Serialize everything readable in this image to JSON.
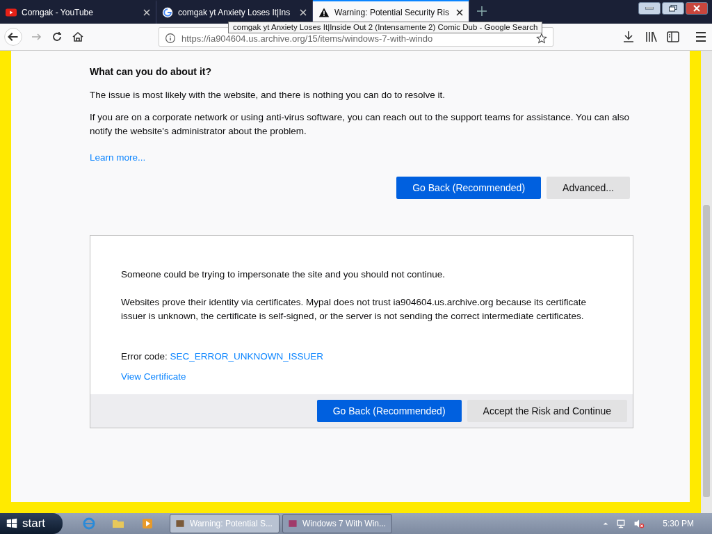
{
  "tabs": [
    {
      "kind": "youtube",
      "title": "Corngak - YouTube",
      "selected": false
    },
    {
      "kind": "google",
      "title": "comgak yt Anxiety Loses It|Ins",
      "selected": false
    },
    {
      "kind": "warning",
      "title": "Warning: Potential Security Ris",
      "selected": true
    }
  ],
  "tooltip": "comgak yt Anxiety Loses It|Inside Out 2 (Intensamente 2) Comic Dub - Google Search",
  "address": "https://ia904604.us.archive.org/15/items/windows-7-with-windo",
  "page": {
    "heading": "What can you do about it?",
    "paragraphs": [
      "The issue is most likely with the website, and there is nothing you can do to resolve it.",
      "If you are on a corporate network or using anti-virus software, you can reach out to the support teams for assistance. You can also notify the website's administrator about the problem."
    ],
    "learn_more": "Learn more...",
    "buttons": [
      "Go Back (Recommended)",
      "Advanced..."
    ],
    "advanced": {
      "intro": "Someone could be trying to impersonate the site and you should not continue.",
      "details": "Websites prove their identity via certificates. Mypal does not trust ia904604.us.archive.org because its certificate issuer is unknown, the certificate is self-signed, or the server is not sending the correct intermediate certificates.",
      "error_label": "Error code:",
      "error_code": "SEC_ERROR_UNKNOWN_ISSUER",
      "view_certificate": "View Certificate",
      "buttons": [
        "Go Back (Recommended)",
        "Accept the Risk and Continue"
      ]
    }
  },
  "taskbar": {
    "start": "start",
    "windows": [
      {
        "title": "Warning: Potential S...",
        "selected": true
      },
      {
        "title": "Windows 7 With Win...",
        "selected": false
      }
    ],
    "clock": "5:30 PM"
  }
}
